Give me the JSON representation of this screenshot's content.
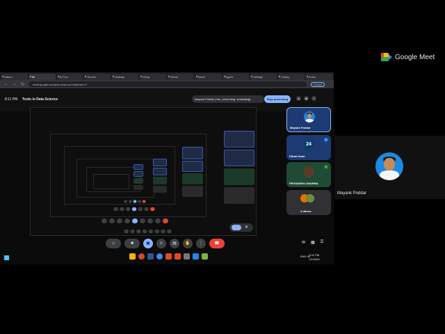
{
  "brand": {
    "name": "Google Meet"
  },
  "browser": {
    "tabs": [
      "Nation",
      "Mi",
      "AI Cou",
      "Studen",
      "settings",
      "Goog",
      "Album",
      "Mode",
      "Agent",
      "settings",
      "Classp",
      "mdns"
    ],
    "url": "meet.google.com/pnw-xbdz-xct?authuser=0",
    "school_chip": "School"
  },
  "meeting": {
    "time": "8:11 PM",
    "title": "Tools in Data Science",
    "presenting_text": "Mayank Poddar (You, presenting, annotating)",
    "stop_label": "Stop presenting",
    "people_count": "7"
  },
  "participants": [
    {
      "name": "Mayank Poddar",
      "badge": ""
    },
    {
      "name": "Dibrat Kaini",
      "badge": "E"
    },
    {
      "name": "PRIYANSHU SHARMA",
      "badge": "E"
    },
    {
      "name": "3 others",
      "badge": ""
    }
  ],
  "self_view": {
    "name": "Mayank Poddar"
  },
  "taskbar": {
    "lang": "ENG\nIN",
    "time": "8:11 PM",
    "date": "1/1/2026"
  }
}
